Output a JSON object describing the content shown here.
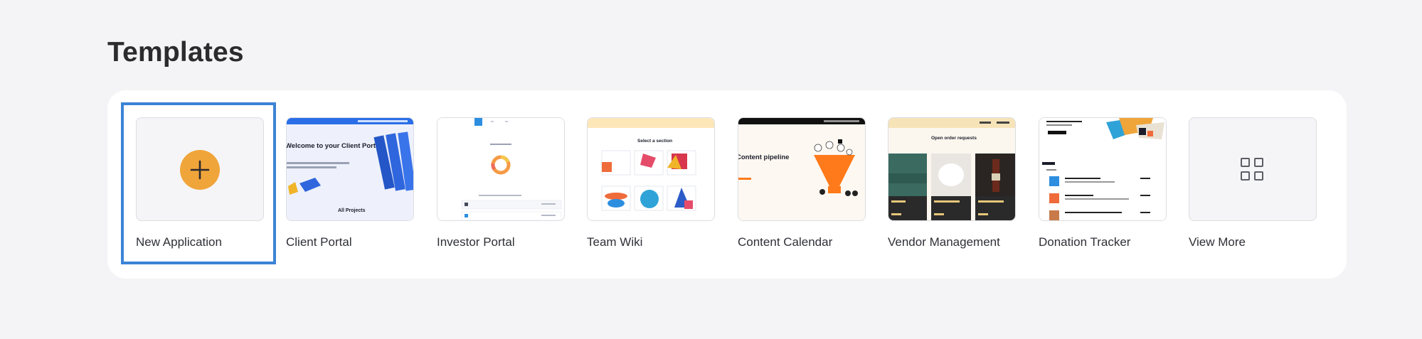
{
  "page": {
    "title": "Templates"
  },
  "colors": {
    "accent": "#3b83d6",
    "plus_circle": "#f0a53a",
    "blue_header": "#2a6ee8",
    "funnel_orange": "#ff7a1a"
  },
  "templates": [
    {
      "label": "New Application",
      "icon": "plus-icon",
      "selected": true
    },
    {
      "label": "Client Portal",
      "heading": "Welcome to your Client Portal",
      "footer": "All Projects"
    },
    {
      "label": "Investor Portal"
    },
    {
      "label": "Team Wiki",
      "heading": "Select a section"
    },
    {
      "label": "Content Calendar",
      "heading": "Content pipeline"
    },
    {
      "label": "Vendor Management",
      "heading": "Open order requests"
    },
    {
      "label": "Donation Tracker"
    },
    {
      "label": "View More",
      "icon": "grid-icon"
    }
  ]
}
